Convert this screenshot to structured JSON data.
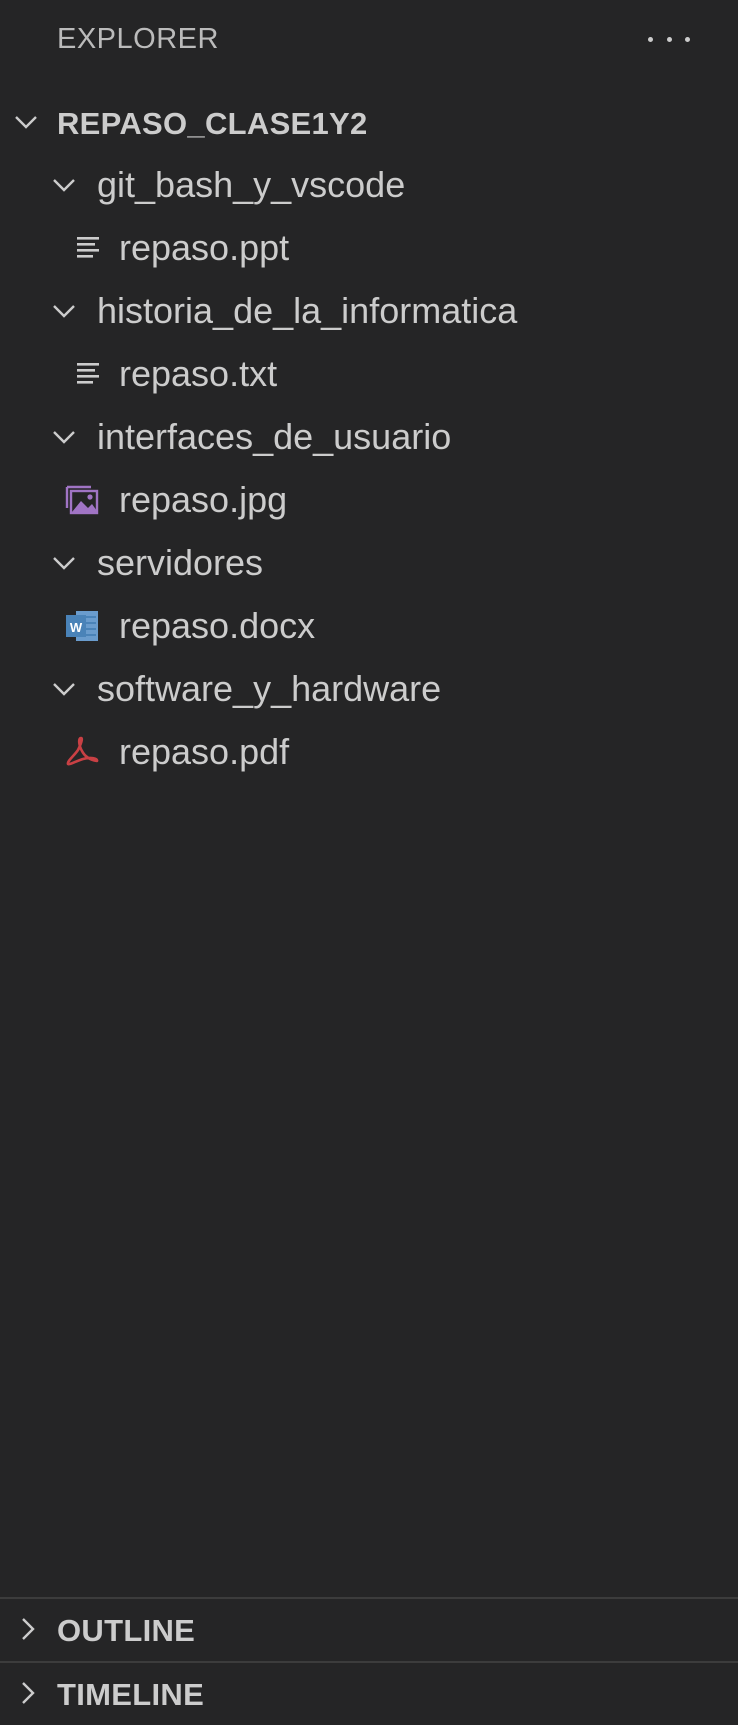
{
  "explorer": {
    "title": "EXPLORER",
    "more_actions_icon": "ellipsis-icon"
  },
  "workspace": {
    "name": "REPASO_CLASE1Y2",
    "expanded": true
  },
  "folders": [
    {
      "name": "git_bash_y_vscode",
      "expanded": true,
      "file": {
        "name": "repaso.ppt",
        "icon": "text-lines-icon"
      }
    },
    {
      "name": "historia_de_la_informatica",
      "expanded": true,
      "file": {
        "name": "repaso.txt",
        "icon": "text-lines-icon"
      }
    },
    {
      "name": "interfaces_de_usuario",
      "expanded": true,
      "file": {
        "name": "repaso.jpg",
        "icon": "image-icon"
      }
    },
    {
      "name": "servidores",
      "expanded": true,
      "file": {
        "name": "repaso.docx",
        "icon": "word-icon"
      }
    },
    {
      "name": "software_y_hardware",
      "expanded": true,
      "file": {
        "name": "repaso.pdf",
        "icon": "pdf-icon"
      }
    }
  ],
  "panels": [
    {
      "name": "OUTLINE",
      "expanded": false
    },
    {
      "name": "TIMELINE",
      "expanded": false
    }
  ],
  "colors": {
    "background": "#252526",
    "text": "#cccccc",
    "image_icon": "#a074c4",
    "word_icon": "#4a83b8",
    "pdf_icon": "#c94044"
  }
}
